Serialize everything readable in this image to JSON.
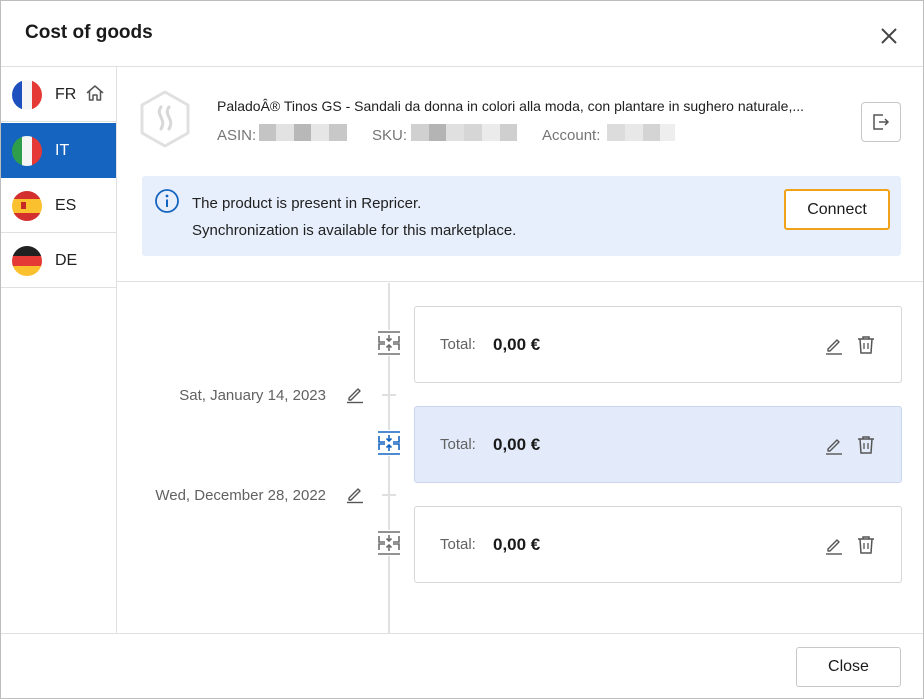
{
  "dialog": {
    "title": "Cost of goods"
  },
  "marketplaces": [
    {
      "code": "FR",
      "flag": "france-flag",
      "home": true,
      "active": false
    },
    {
      "code": "IT",
      "flag": "italy-flag",
      "home": false,
      "active": true
    },
    {
      "code": "ES",
      "flag": "spain-flag",
      "home": false,
      "active": false
    },
    {
      "code": "DE",
      "flag": "germany-flag",
      "home": false,
      "active": false
    }
  ],
  "product": {
    "name": "PaladoÂ® Tinos GS - Sandali da donna in colori alla moda, con plantare in sughero naturale,...",
    "asin_label": "ASIN:",
    "sku_label": "SKU:",
    "account_label": "Account:"
  },
  "alert": {
    "line1": "The product is present in Repricer.",
    "line2": "Synchronization is available for this marketplace.",
    "connect_label": "Connect"
  },
  "timeline": {
    "dates": [
      "Sat, January 14, 2023",
      "Wed, December 28, 2022"
    ],
    "entries": [
      {
        "label": "Total:",
        "value": "0,00 €",
        "selected": false
      },
      {
        "label": "Total:",
        "value": "0,00 €",
        "selected": true
      },
      {
        "label": "Total:",
        "value": "0,00 €",
        "selected": false
      }
    ]
  },
  "footer": {
    "close_label": "Close"
  },
  "colors": {
    "accent": "#1565c0",
    "highlight": "#f0a31a",
    "alert_bg": "#e8effc",
    "selected_card": "#e3ebfa"
  }
}
